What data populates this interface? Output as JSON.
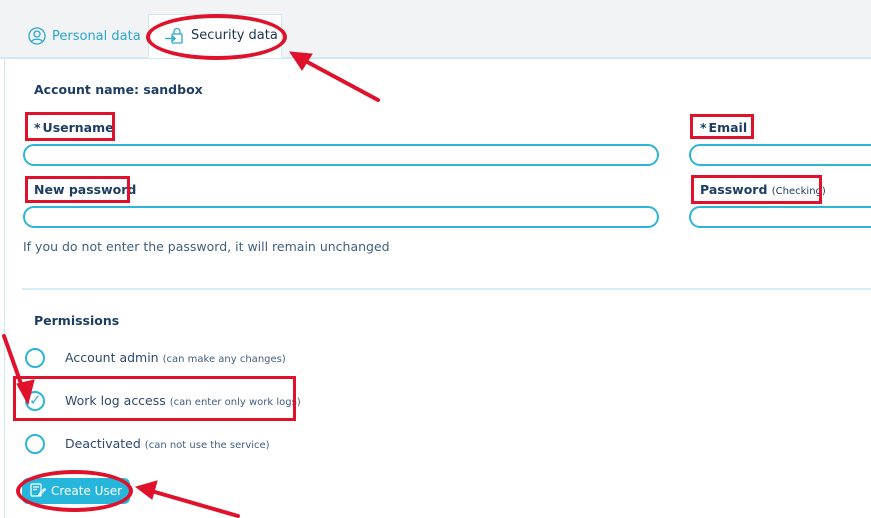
{
  "tabs": {
    "personal_label": "Personal data",
    "security_label": "Security data"
  },
  "form": {
    "account_name": "Account name: sandbox",
    "username_label": "Username",
    "email_label": "Email",
    "required_marker": "*",
    "new_password_label": "New password",
    "password_label": "Password",
    "password_check_label": "(Checking)",
    "username_value": "",
    "email_value": "",
    "new_password_value": "",
    "password_check_value": "",
    "password_hint": "If you do not enter the password, it will remain unchanged"
  },
  "permissions": {
    "title": "Permissions",
    "options": [
      {
        "label": "Account admin",
        "note": "(can make any changes)",
        "checked": false
      },
      {
        "label": "Work log access",
        "note": "(can enter only work logs)",
        "checked": true
      },
      {
        "label": "Deactivated",
        "note": "(can not use the service)",
        "checked": false
      }
    ]
  },
  "actions": {
    "create_label": "Create User"
  },
  "colors": {
    "accent": "#2cb5d8",
    "text": "#1e3d63",
    "annotation": "#e0112b"
  }
}
